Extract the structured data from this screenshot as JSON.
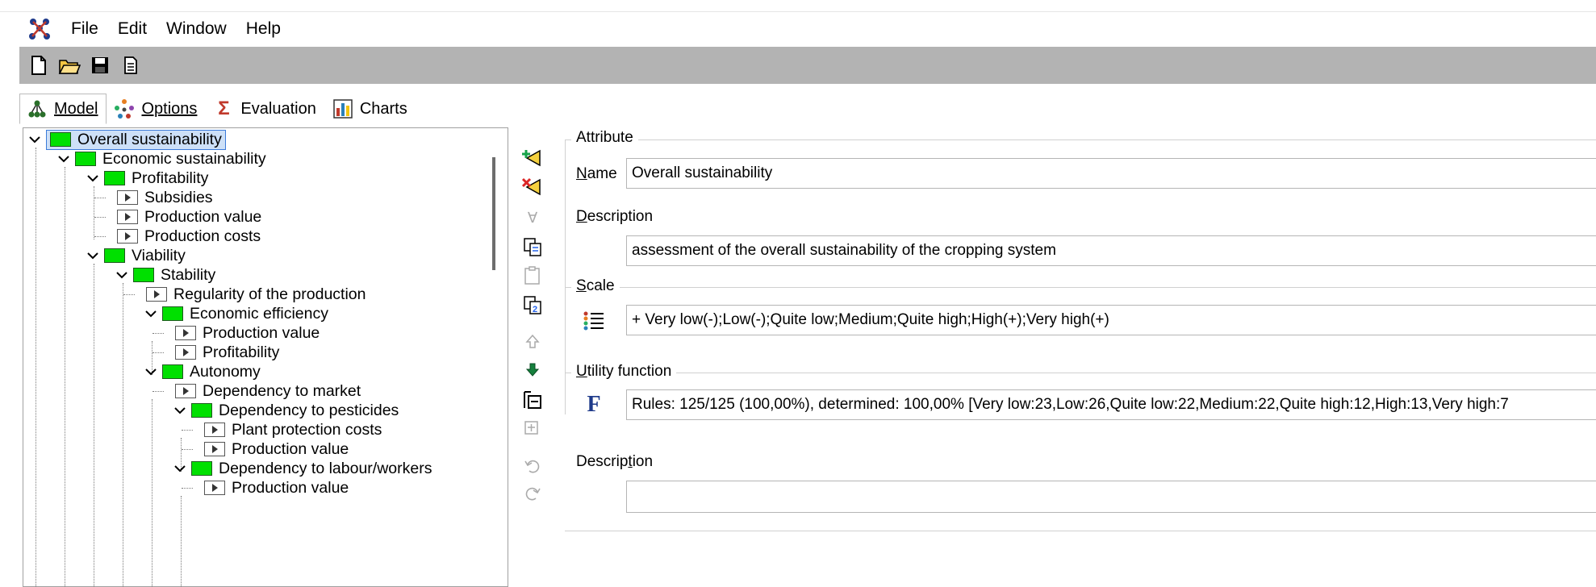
{
  "menu": {
    "file": "File",
    "edit": "Edit",
    "window": "Window",
    "help": "Help"
  },
  "tabs": [
    {
      "label": "Model",
      "icon": "tree-icon"
    },
    {
      "label": "Options",
      "icon": "dots-icon"
    },
    {
      "label": "Evaluation",
      "icon": "sigma-icon"
    },
    {
      "label": "Charts",
      "icon": "chart-icon"
    }
  ],
  "tree": {
    "root": "Overall sustainability",
    "nodes": [
      "Economic sustainability",
      "Profitability",
      "Subsidies",
      "Production value",
      "Production costs",
      "Viability",
      "Stability",
      "Regularity of the production",
      "Economic efficiency",
      "Production value",
      "Profitability",
      "Autonomy",
      "Dependency to market",
      "Dependency to pesticides",
      "Plant protection costs",
      "Production value",
      "Dependency to labour/workers",
      "Production value"
    ]
  },
  "attribute": {
    "legend": "Attribute",
    "name_label": "Name",
    "name_value": "Overall sustainability",
    "description_label": "Description",
    "description_value": "assessment of the overall sustainability of the cropping system"
  },
  "scale": {
    "legend": "Scale",
    "value": "+ Very low(-);Low(-);Quite low;Medium;Quite high;High(+);Very high(+)"
  },
  "utility": {
    "legend": "Utility function",
    "value": "Rules: 125/125 (100,00%), determined: 100,00% [Very low:23,Low:26,Quite low:22,Medium:22,Quite high:12,High:13,Very high:7",
    "description_label": "Description",
    "description_value": ""
  }
}
